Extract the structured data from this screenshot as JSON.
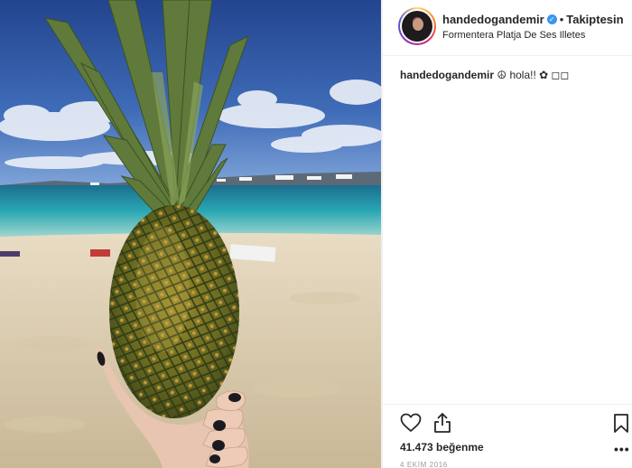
{
  "post": {
    "username": "handedogandemir",
    "verified_icon": "verified-badge-icon",
    "separator": "•",
    "follow_label": "Takiptesin",
    "location": "Formentera Platja De Ses Illetes",
    "caption_user": "handedogandemir",
    "caption_text": "☮ hola!! ✿ ◻◻",
    "likes_text": "41.473 beğenme",
    "date": "4 EKİM 2016",
    "more_label": "•••"
  },
  "icons": {
    "like": "heart-icon",
    "share": "share-icon",
    "save": "bookmark-icon"
  },
  "colors": {
    "verified": "#3897f0",
    "text": "#262626",
    "muted": "#999999",
    "flower": "#e84a9a"
  }
}
